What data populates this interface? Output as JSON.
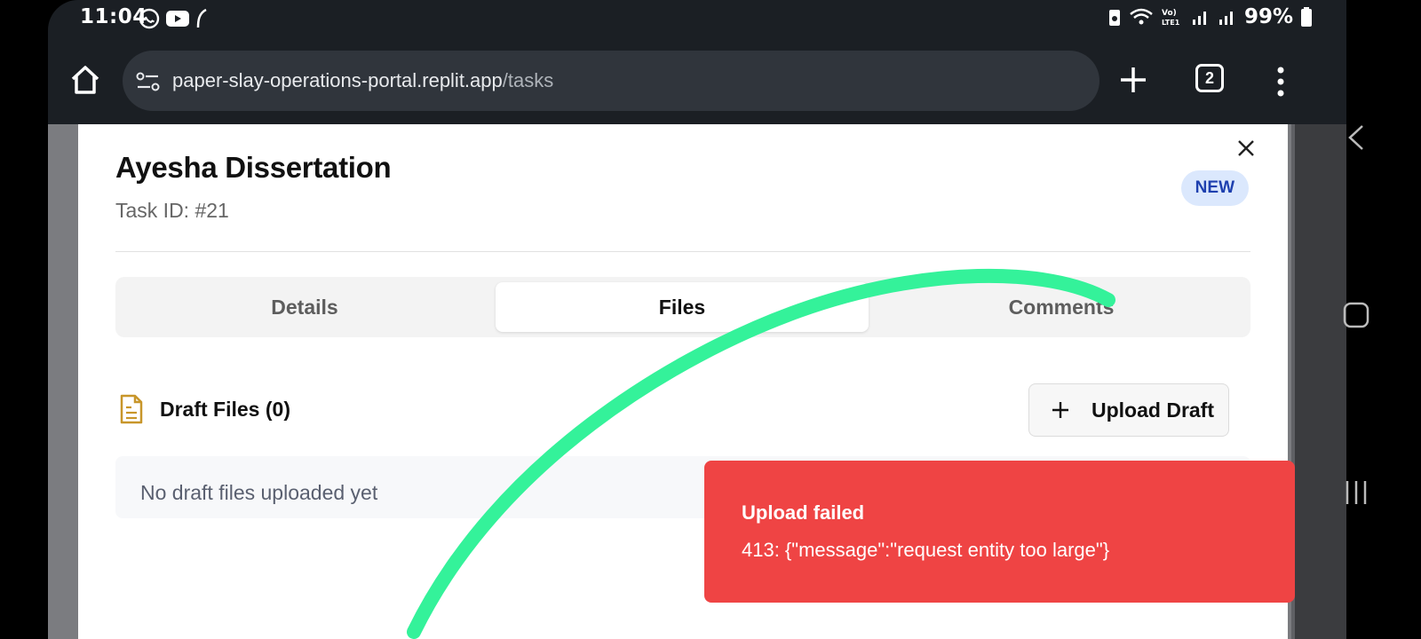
{
  "status_bar": {
    "time": "11:04",
    "battery": "99%",
    "icons_left": [
      "whatsapp-icon",
      "youtube-icon",
      "feather-icon"
    ],
    "icons_right": [
      "battery-saver-icon",
      "wifi-icon",
      "volte-icon",
      "signal-icon",
      "signal-icon",
      "battery-icon"
    ],
    "volte_label": "Vo) LTE1"
  },
  "browser": {
    "url_domain": "paper-slay-operations-portal.replit.app",
    "url_path": "/tasks",
    "tab_count": "2"
  },
  "modal": {
    "title": "Ayesha Dissertation",
    "task_id": "Task ID: #21",
    "badge": "NEW",
    "tabs": [
      {
        "label": "Details",
        "active": false
      },
      {
        "label": "Files",
        "active": true
      },
      {
        "label": "Comments",
        "active": false
      }
    ],
    "draft_files_label": "Draft Files (0)",
    "upload_button": "Upload Draft",
    "empty_state": "No draft files uploaded yet"
  },
  "toast": {
    "title": "Upload failed",
    "message": "413: {\"message\":\"request entity too large\"}",
    "color": "#ef4444"
  },
  "colors": {
    "accent_badge_bg": "#dbe8fd",
    "accent_badge_text": "#1e40af",
    "draft_icon": "#c8962a",
    "annotation_stroke": "#34f29a"
  }
}
